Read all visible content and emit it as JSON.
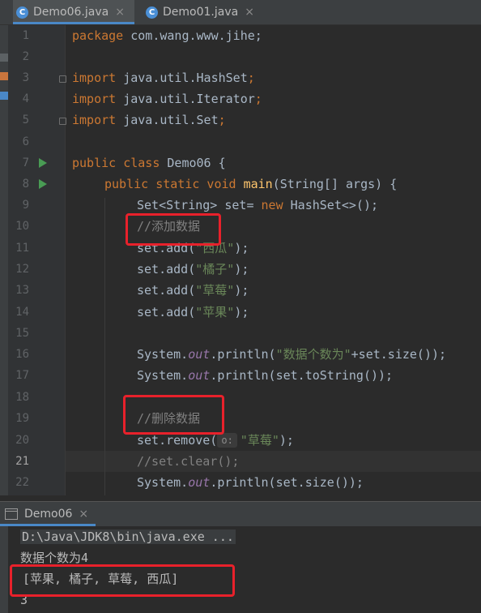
{
  "tabs": [
    {
      "label": "Demo06.java",
      "icon": "java-class-icon",
      "active": true
    },
    {
      "label": "Demo01.java",
      "icon": "java-class-icon",
      "active": false
    }
  ],
  "icons": {
    "class_icon_letter": "C",
    "close": "×"
  },
  "editor": {
    "line_numbers": [
      "1",
      "2",
      "3",
      "4",
      "5",
      "6",
      "7",
      "8",
      "9",
      "10",
      "11",
      "12",
      "13",
      "14",
      "15",
      "16",
      "17",
      "18",
      "19",
      "20",
      "21",
      "22"
    ],
    "current_line": "21",
    "parameter_hint": "o:",
    "code": {
      "l1": {
        "kw": "package",
        "rest": " com.wang.www.jihe;"
      },
      "l3": {
        "kw": "import",
        "rest": " java.util.HashSet",
        "semi": ";"
      },
      "l4": {
        "kw": "import",
        "rest": " java.util.Iterator",
        "semi": ";"
      },
      "l5": {
        "kw": "import",
        "rest": " java.util.Set",
        "semi": ";"
      },
      "l7": {
        "kw": "public class",
        "rest": " Demo06 {"
      },
      "l8": {
        "kw": "public static void",
        "fn": "main",
        "rest": "(String[] args) {"
      },
      "l9": {
        "a": "Set<String> set= ",
        "kw": "new",
        "b": " HashSet<>();"
      },
      "l10": {
        "comment": "//添加数据"
      },
      "l11": {
        "a": "set.add(",
        "str": "\"西瓜\"",
        "b": ");"
      },
      "l12": {
        "a": "set.add(",
        "str": "\"橘子\"",
        "b": ");"
      },
      "l13": {
        "a": "set.add(",
        "str": "\"草莓\"",
        "b": ");"
      },
      "l14": {
        "a": "set.add(",
        "str": "\"苹果\"",
        "b": ");"
      },
      "l16": {
        "a": "System.",
        "fld": "out",
        "b": ".println(",
        "str": "\"数据个数为\"",
        "c": "+set.size());"
      },
      "l17": {
        "a": "System.",
        "fld": "out",
        "b": ".println(set.toString());"
      },
      "l19": {
        "comment": "//删除数据"
      },
      "l20": {
        "a": "set.remove(",
        "str": "\"草莓\"",
        "b": ");"
      },
      "l21": {
        "comment": "//set.clear();"
      },
      "l22": {
        "a": "System.",
        "fld": "out",
        "b": ".println(set.size());"
      }
    }
  },
  "run_panel": {
    "tab_label": "Demo06",
    "close": "×",
    "output": [
      "D:\\Java\\JDK8\\bin\\java.exe ...",
      "数据个数为4",
      "[苹果, 橘子, 草莓, 西瓜]",
      "3"
    ]
  },
  "colors": {
    "background": "#2b2b2b",
    "keyword": "#cc7832",
    "string": "#6a8759",
    "comment": "#808080",
    "field": "#9876aa",
    "method": "#ffc66d",
    "text": "#a9b7c6",
    "highlight_box": "#e8212b"
  }
}
